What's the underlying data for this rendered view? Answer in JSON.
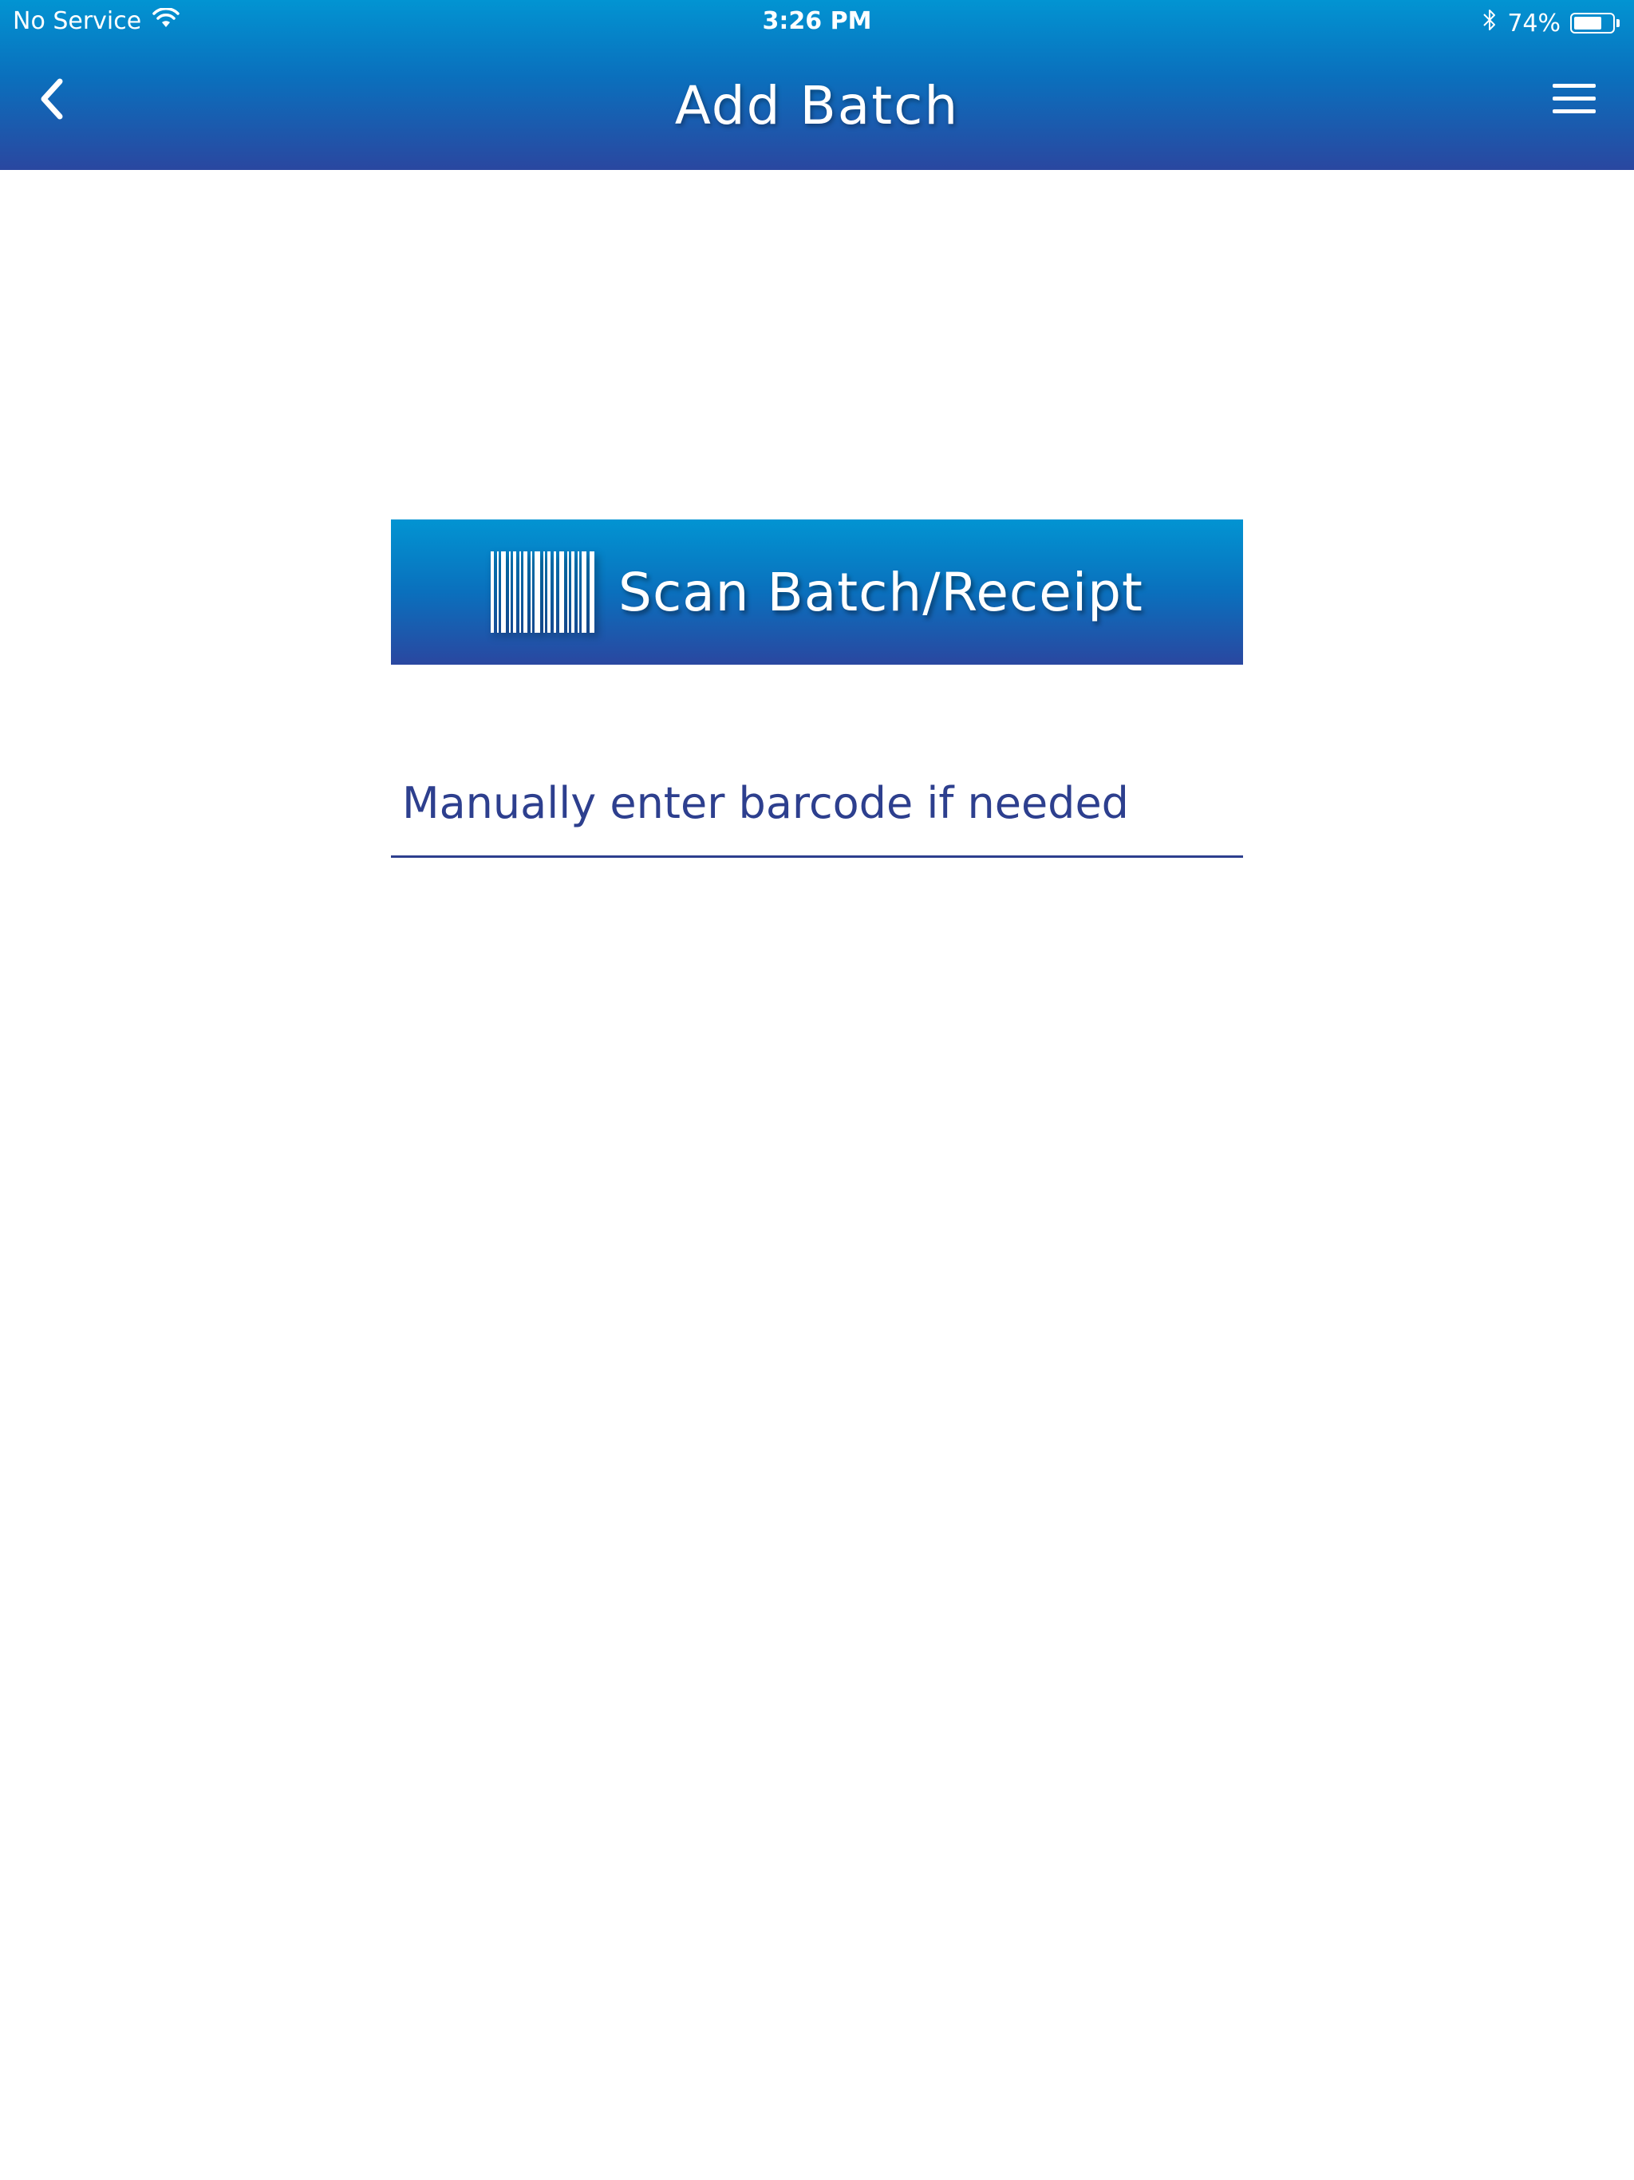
{
  "status_bar": {
    "carrier": "No Service",
    "time": "3:26 PM",
    "battery_percent_label": "74%",
    "battery_level": 0.74,
    "icons": [
      "wifi-icon",
      "bluetooth-icon",
      "battery-icon"
    ]
  },
  "nav_bar": {
    "title": "Add Batch",
    "back_icon": "chevron-left-icon",
    "menu_icon": "hamburger-menu-icon"
  },
  "main": {
    "scan_button": {
      "label": "Scan Batch/Receipt",
      "icon": "barcode-icon"
    },
    "barcode_input": {
      "value": "",
      "placeholder": "Manually enter barcode if needed"
    }
  },
  "colors": {
    "header_top": "#0294d2",
    "header_bottom": "#2a47a0",
    "accent_text": "#2d3f8e",
    "background": "#ffffff"
  }
}
